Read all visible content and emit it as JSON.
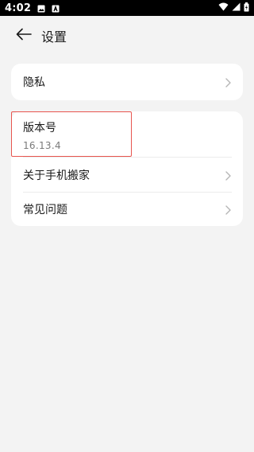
{
  "status_bar": {
    "time": "4:02"
  },
  "header": {
    "title": "设置"
  },
  "card_privacy": {
    "label": "隐私"
  },
  "card_about": {
    "version_title": "版本号",
    "version_value": "16.13.4",
    "about_label": "关于手机搬家",
    "faq_label": "常见问题"
  },
  "colors": {
    "background": "#f3f3f3",
    "card": "#ffffff",
    "highlight_border": "#e8554f",
    "status_bar": "#000000"
  },
  "icons": {
    "back": "arrow-left-icon",
    "chevron": "chevron-right-icon"
  }
}
